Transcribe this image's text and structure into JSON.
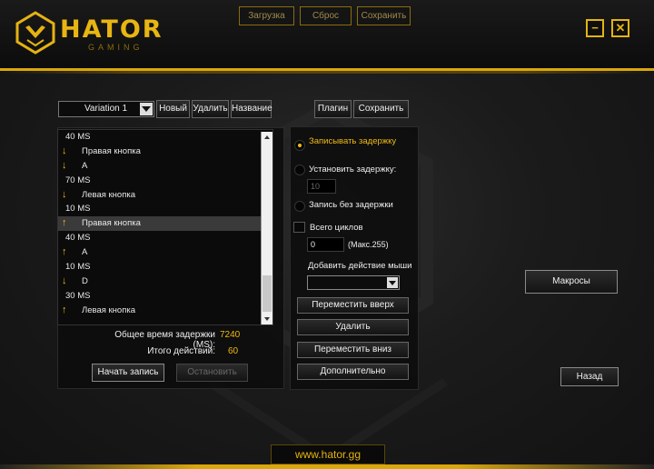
{
  "brand": {
    "name": "HATOR",
    "sub": "GAMING"
  },
  "topbar": {
    "load": "Загрузка",
    "reset": "Сброс",
    "save": "Сохранить"
  },
  "window": {
    "minimize": "−",
    "close": "✕"
  },
  "macro": {
    "variation_selected": "Variation 1",
    "buttons": {
      "new": "Новый",
      "delete": "Удалить",
      "name": "Название",
      "plugin": "Плагин",
      "save": "Сохранить"
    },
    "list": [
      {
        "type": "delay",
        "icon": "",
        "text": "40 MS"
      },
      {
        "type": "key",
        "icon": "arrow-down",
        "text": "Правая кнопка"
      },
      {
        "type": "key",
        "icon": "arrow-down",
        "text": "A"
      },
      {
        "type": "delay",
        "icon": "",
        "text": "70 MS"
      },
      {
        "type": "key",
        "icon": "arrow-down",
        "text": "Левая кнопка"
      },
      {
        "type": "delay",
        "icon": "",
        "text": "10 MS"
      },
      {
        "type": "key",
        "icon": "arrow-up",
        "text": "Правая кнопка",
        "selected": true
      },
      {
        "type": "delay",
        "icon": "",
        "text": "40 MS"
      },
      {
        "type": "key",
        "icon": "arrow-up",
        "text": "A"
      },
      {
        "type": "delay",
        "icon": "",
        "text": "10 MS"
      },
      {
        "type": "key",
        "icon": "arrow-down",
        "text": "D"
      },
      {
        "type": "delay",
        "icon": "",
        "text": "30 MS"
      },
      {
        "type": "key",
        "icon": "arrow-up",
        "text": "Левая кнопка"
      }
    ],
    "total_delay_label": "Общее время задержки (MS):",
    "total_delay_value": "7240",
    "total_actions_label": "Итого действий:",
    "total_actions_value": "60",
    "start_record": "Начать запись",
    "stop": "Остановить"
  },
  "options": {
    "record_delay": "Записывать задержку",
    "set_delay": "Установить задержку:",
    "set_delay_value": "10",
    "no_delay": "Запись без задержки",
    "cycles_label": "Всего циклов",
    "cycles_value": "0",
    "cycles_max": "(Макс.255)",
    "add_mouse_action": "Добавить действие мыши",
    "move_up": "Переместить вверх",
    "delete": "Удалить",
    "move_down": "Переместить вниз",
    "advanced": "Дополнительно"
  },
  "right": {
    "macros": "Макросы",
    "back": "Назад"
  },
  "footer": {
    "url": "www.hator.gg"
  },
  "colors": {
    "accent": "#e5b312",
    "background": "#1b1b1b"
  }
}
